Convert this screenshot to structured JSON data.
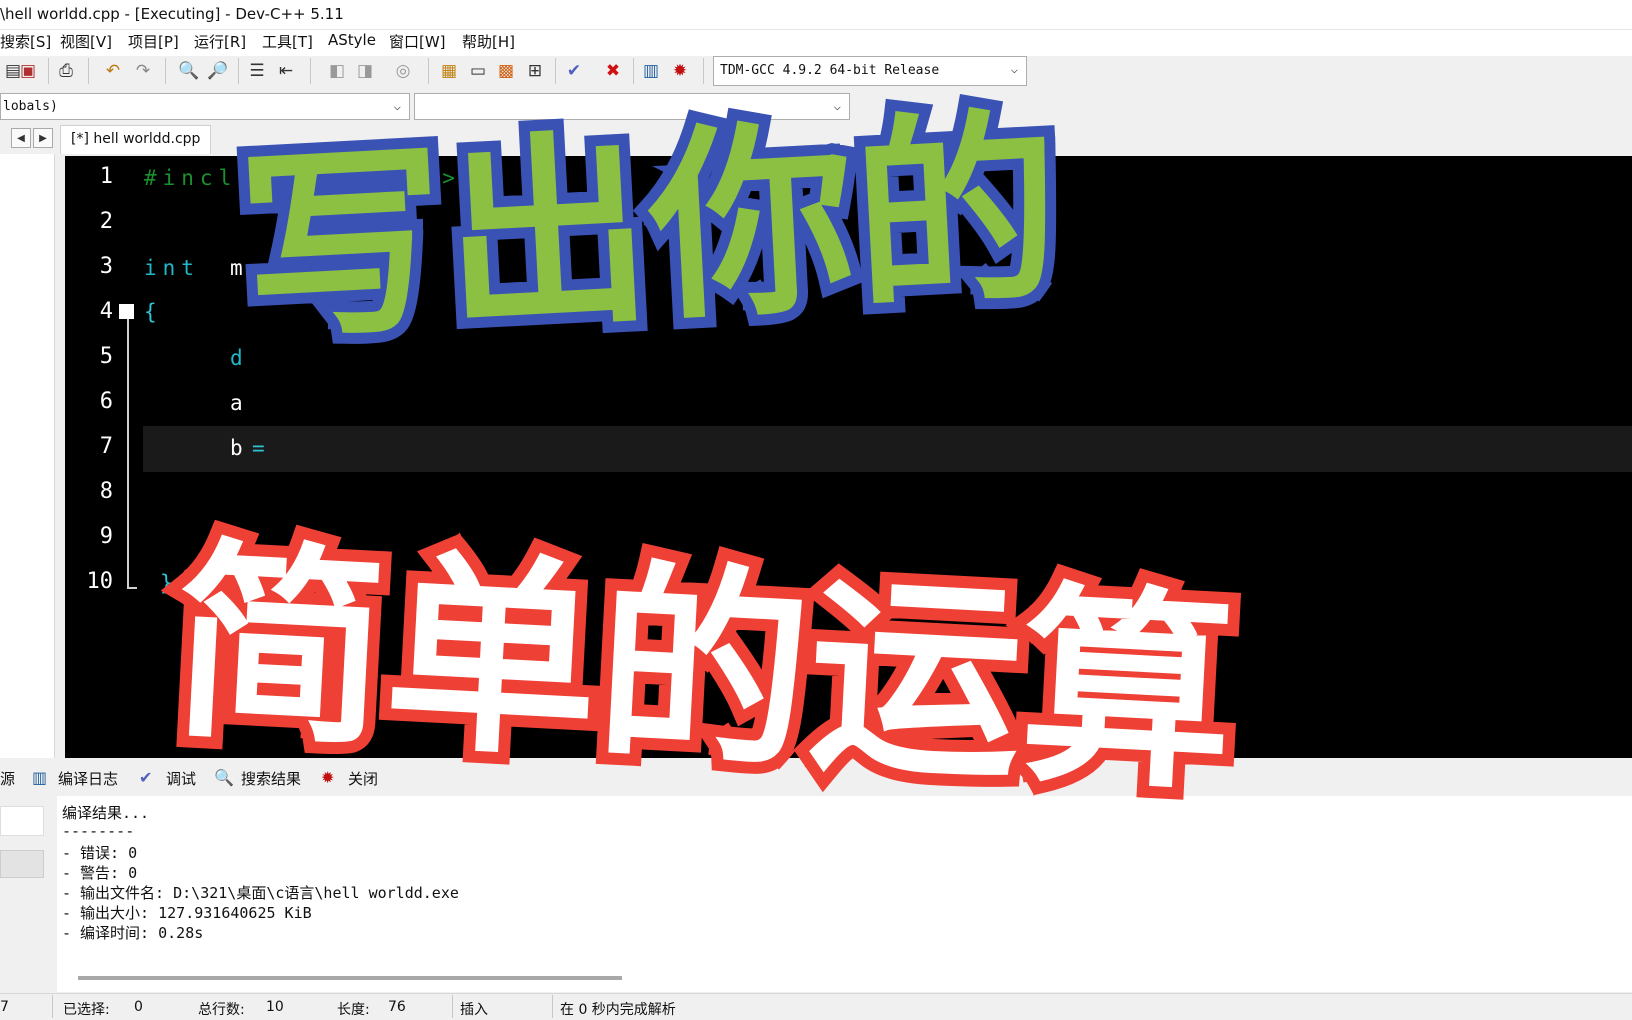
{
  "window": {
    "title": "\\hell worldd.cpp - [Executing] - Dev-C++ 5.11"
  },
  "menu": [
    {
      "label": "搜索[S]"
    },
    {
      "label": "视图[V]"
    },
    {
      "label": "项目[P]"
    },
    {
      "label": "运行[R]"
    },
    {
      "label": "工具[T]"
    },
    {
      "label": "AStyle"
    },
    {
      "label": "窗口[W]"
    },
    {
      "label": "帮助[H]"
    }
  ],
  "toolbar": {
    "icons": [
      "new-icon",
      "save-icon",
      "print-icon",
      "undo-icon",
      "redo-icon",
      "find-icon",
      "replace-icon",
      "indent-icon",
      "unindent-icon",
      "bookmark-icon",
      "goto-icon",
      "toggle-comment-icon",
      "compile-icon",
      "run-icon",
      "compile-run-icon",
      "rebuild-icon",
      "syntax-check-icon",
      "stop-icon",
      "chart-icon",
      "debug-icon"
    ],
    "compiler": "TDM-GCC 4.9.2 64-bit Release"
  },
  "classbar": {
    "scope": "lobals)",
    "member": ""
  },
  "tabs": {
    "file": "[*] hell worldd.cpp"
  },
  "editor": {
    "line_numbers": [
      "1",
      "2",
      "3",
      "4",
      "5",
      "6",
      "7",
      "8",
      "9",
      "10"
    ],
    "code": {
      "line1": "#include<stdio.h>",
      "line3_kw": "int",
      "line3_id": "m",
      "line4": "{",
      "line5": "d",
      "line6": "a",
      "line7_id": "b",
      "line7_op": "=",
      "line10": "}"
    }
  },
  "overlay": {
    "title1": "写出你的",
    "title2": "简单的运算"
  },
  "bottom_tabs": [
    {
      "label": "源",
      "icon": ""
    },
    {
      "label": "编译日志",
      "icon": "chart-icon"
    },
    {
      "label": "调试",
      "icon": "check-icon"
    },
    {
      "label": "搜索结果",
      "icon": "search-icon"
    },
    {
      "label": "关闭",
      "icon": "close-icon"
    }
  ],
  "log": [
    "编译结果...",
    "--------",
    "- 错误: 0",
    "- 警告: 0",
    "- 输出文件名: D:\\321\\桌面\\c语言\\hell worldd.exe",
    "- 输出大小: 127.931640625 KiB",
    "- 编译时间: 0.28s"
  ],
  "status": {
    "line": "7",
    "selected_label": "已选择:",
    "selected_value": "0",
    "total_label": "总行数:",
    "total_value": "10",
    "length_label": "长度:",
    "length_value": "76",
    "mode": "插入",
    "parse": "在 0 秒内完成解析"
  },
  "colors": {
    "preprocessor": "#1a8f2e",
    "keyword": "#1fb9c9",
    "overlay1_fill": "#8cc043",
    "overlay1_stroke": "#3b52b5",
    "overlay2_fill": "#ffffff",
    "overlay2_stroke": "#ef4035"
  }
}
